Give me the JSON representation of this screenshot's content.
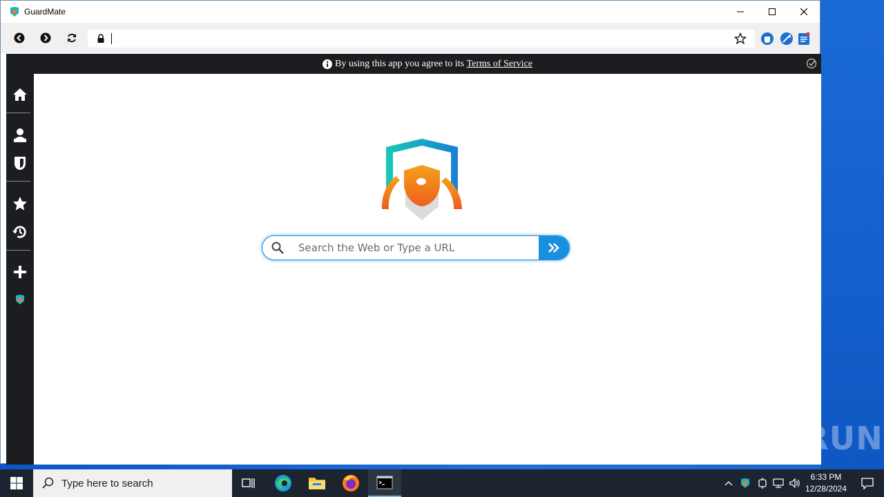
{
  "window": {
    "title": "GuardMate"
  },
  "toolbar": {
    "address_value": ""
  },
  "notice": {
    "prefix": "By using this app you agree to its",
    "link": "Terms of Service"
  },
  "sidebar": {
    "items": [
      "home-icon",
      "user-icon",
      "shield-icon",
      "star-icon",
      "history-icon",
      "plus-icon",
      "guardmate-app-icon"
    ]
  },
  "search": {
    "placeholder": "Search the Web or Type a URL"
  },
  "watermark": {
    "text": "ANY RUN"
  },
  "taskbar": {
    "search_placeholder": "Type here to search",
    "time": "6:33 PM",
    "date": "12/28/2024"
  },
  "colors": {
    "accent": "#1a8fe0",
    "sidebar_bg": "#1b1d20",
    "taskbar_bg": "#1c2430"
  }
}
